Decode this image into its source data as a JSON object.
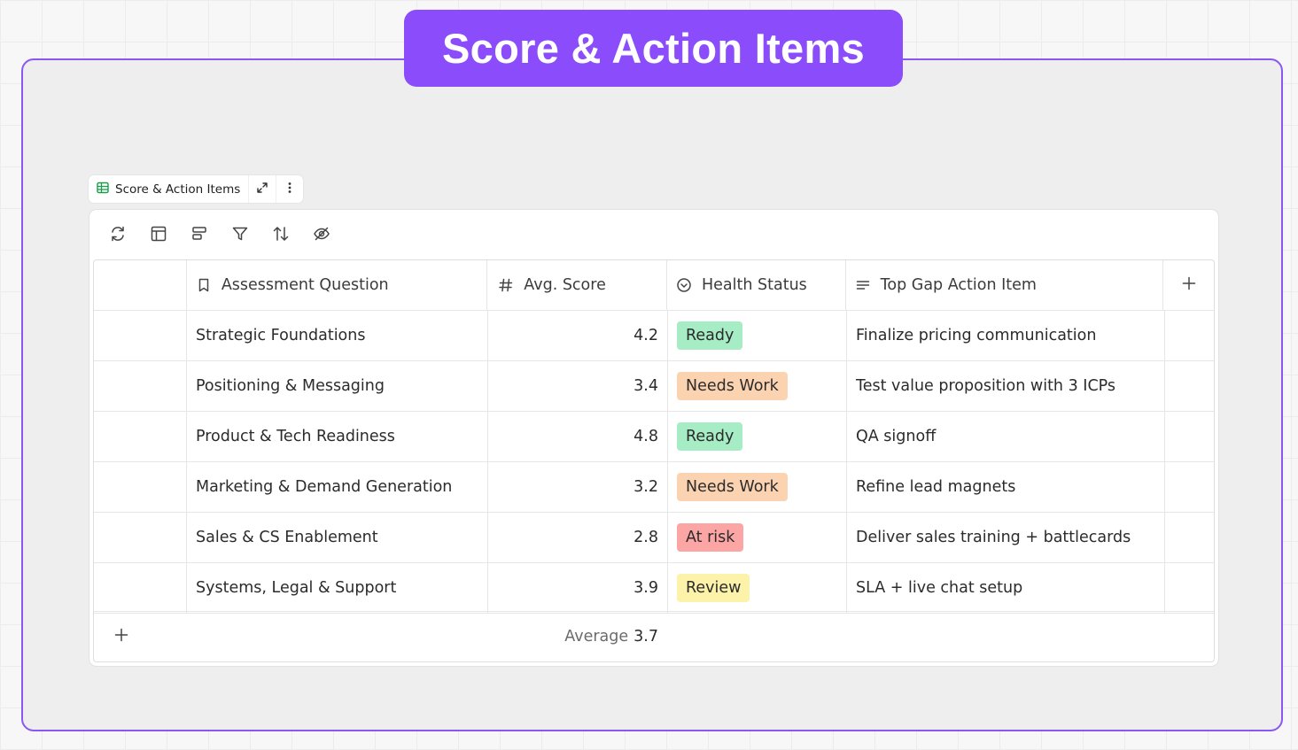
{
  "banner": {
    "title": "Score & Action Items"
  },
  "widget": {
    "tab_label": "Score & Action Items"
  },
  "toolbar": {
    "icons": [
      "refresh-icon",
      "layout-icon",
      "group-icon",
      "filter-icon",
      "sort-icon",
      "hide-icon"
    ]
  },
  "table": {
    "columns": [
      {
        "label": "Assessment Question",
        "icon": "bookmark-icon"
      },
      {
        "label": "Avg. Score",
        "icon": "hash-icon"
      },
      {
        "label": "Health Status",
        "icon": "status-icon"
      },
      {
        "label": "Top Gap Action Item",
        "icon": "text-lines-icon"
      }
    ],
    "rows": [
      {
        "question": "Strategic Foundations",
        "score": "4.2",
        "status": "Ready",
        "action": "Finalize pricing communication"
      },
      {
        "question": "Positioning & Messaging",
        "score": "3.4",
        "status": "Needs Work",
        "action": "Test value proposition with 3 ICPs"
      },
      {
        "question": "Product & Tech Readiness",
        "score": "4.8",
        "status": "Ready",
        "action": "QA signoff"
      },
      {
        "question": "Marketing & Demand Generation",
        "score": "3.2",
        "status": "Needs Work",
        "action": "Refine lead magnets"
      },
      {
        "question": "Sales & CS Enablement",
        "score": "2.8",
        "status": "At risk",
        "action": "Deliver sales training + battlecards"
      },
      {
        "question": "Systems, Legal & Support",
        "score": "3.9",
        "status": "Review",
        "action": "SLA + live chat setup"
      }
    ],
    "status_colors": {
      "Ready": "#a6ecc4",
      "Needs Work": "#fcd3b1",
      "At risk": "#fca5a5",
      "Review": "#fcf2a9"
    },
    "footer": {
      "avg_label": "Average",
      "avg_value": "3.7"
    }
  },
  "colors": {
    "accent": "#8b4dfb",
    "frame_border": "#8a57f2"
  }
}
